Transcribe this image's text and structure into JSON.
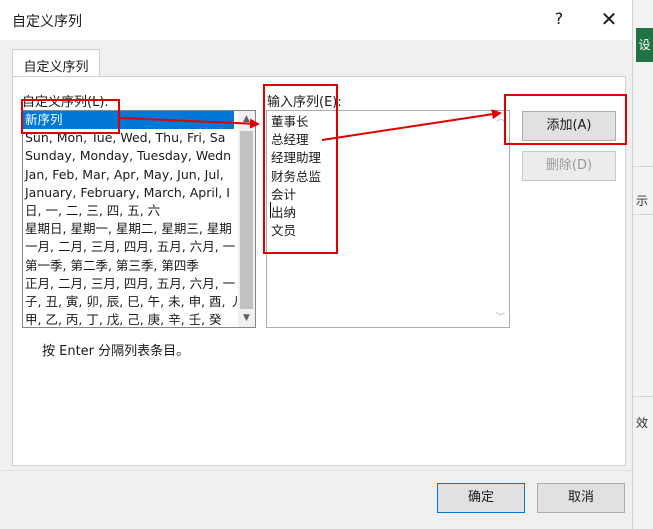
{
  "dialog": {
    "title": "自定义序列",
    "help_icon": "?",
    "close_icon": "✕",
    "tab_label": "自定义序列",
    "custom_lists_label": "自定义序列(L):",
    "list_entries_label": "输入序列(E):",
    "custom_lists": [
      "新序列",
      "Sun, Mon, Tue, Wed, Thu, Fri, Sa",
      "Sunday, Monday, Tuesday, Wedn",
      "Jan, Feb, Mar, Apr, May, Jun, Jul,",
      "January, February, March, April, I",
      "日, 一, 二, 三, 四, 五, 六",
      "星期日, 星期一, 星期二, 星期三, 星期",
      "一月, 二月, 三月, 四月, 五月, 六月, 一",
      "第一季, 第二季, 第三季, 第四季",
      "正月, 二月, 三月, 四月, 五月, 六月, 一",
      "子, 丑, 寅, 卯, 辰, 巳, 午, 未, 申, 酉, 丿",
      "甲, 乙, 丙, 丁, 戊, 己, 庚, 辛, 壬, 癸"
    ],
    "entries": [
      "董事长",
      "总经理",
      "经理助理",
      "财务总监",
      "会计",
      "出纳",
      "文员"
    ],
    "add_button": "添加(A)",
    "delete_button": "删除(D)",
    "hint": "按 Enter 分隔列表条目。",
    "ok_button": "确定",
    "cancel_button": "取消"
  },
  "background_strip": {
    "top_text": "设",
    "mid_text": "示",
    "low_text": "效"
  },
  "colors": {
    "selection": "#0078d7",
    "annotation_red": "#e00000",
    "excel_green": "#217346"
  }
}
